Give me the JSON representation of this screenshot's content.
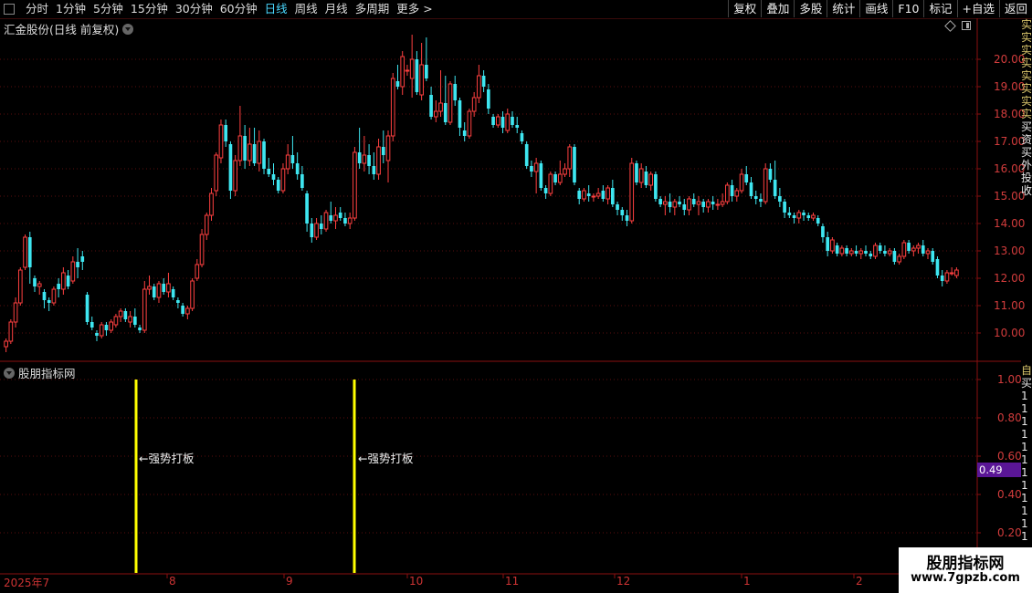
{
  "toolbar": {
    "periods": [
      {
        "label": "分时"
      },
      {
        "label": "1分钟"
      },
      {
        "label": "5分钟"
      },
      {
        "label": "15分钟"
      },
      {
        "label": "30分钟"
      },
      {
        "label": "60分钟"
      },
      {
        "label": "日线",
        "active": true
      },
      {
        "label": "周线"
      },
      {
        "label": "月线"
      },
      {
        "label": "多周期"
      },
      {
        "label": "更多"
      }
    ],
    "more_suffix": ">",
    "right_buttons": [
      "复权",
      "叠加",
      "多股",
      "统计",
      "画线",
      "F10",
      "标记",
      "+自选",
      "返回"
    ]
  },
  "main_chart": {
    "title": "汇金股份(日线 前复权)",
    "price_axis": [
      "20.00",
      "19.00",
      "18.00",
      "17.00",
      "16.00",
      "15.00",
      "14.00",
      "13.00",
      "12.00",
      "11.00",
      "10.00"
    ],
    "ymin": 9.0,
    "ymax": 20.9,
    "colors": {
      "up": "#ff4040",
      "down": "#3ee6f0",
      "grid": "#5a0e0e",
      "axis": "#8a1010",
      "axis_text": "#d23c3c"
    }
  },
  "indicator": {
    "title": "股朋指标网",
    "axis_labels": [
      "1.00",
      "0.80",
      "0.60",
      "0.40",
      "0.20"
    ],
    "current_value": "0.49",
    "signal_text": "←强势打板",
    "signal_color": "#ffff00"
  },
  "date_axis": {
    "labels": [
      "2025年7",
      "8",
      "9",
      "10",
      "11",
      "12",
      "1",
      "2"
    ]
  },
  "side_strip": {
    "top_chars": [
      "实",
      "实",
      "实",
      "实",
      "实",
      "实",
      "实",
      "实",
      "买",
      "资",
      "买",
      "外",
      "投",
      "收"
    ],
    "bottom_chars": [
      "自",
      "买",
      "1",
      "1",
      "1",
      "1",
      "1",
      "1",
      "1",
      "1",
      "1",
      "1",
      "1",
      "1"
    ]
  },
  "watermark": {
    "title": "股朋指标网",
    "url": "www.7gpzb.com"
  },
  "candles": [
    [
      9.5,
      9.8,
      9.3,
      9.7
    ],
    [
      9.7,
      10.5,
      9.6,
      10.4
    ],
    [
      10.4,
      11.3,
      10.2,
      11.1
    ],
    [
      11.1,
      12.4,
      11.0,
      12.3
    ],
    [
      12.4,
      13.6,
      12.3,
      13.5
    ],
    [
      13.5,
      13.7,
      11.8,
      12.4
    ],
    [
      12.0,
      12.1,
      11.5,
      11.7
    ],
    [
      11.7,
      11.9,
      11.4,
      11.8
    ],
    [
      11.5,
      11.6,
      10.9,
      11.2
    ],
    [
      11.2,
      11.3,
      10.8,
      11.1
    ],
    [
      11.1,
      11.7,
      11.0,
      11.6
    ],
    [
      11.8,
      12.0,
      11.3,
      11.6
    ],
    [
      11.6,
      12.4,
      11.4,
      12.2
    ],
    [
      12.1,
      12.3,
      11.6,
      11.7
    ],
    [
      11.9,
      12.8,
      11.8,
      12.6
    ],
    [
      12.6,
      13.1,
      12.0,
      12.4
    ],
    [
      12.8,
      13.0,
      12.3,
      12.6
    ],
    [
      11.4,
      11.5,
      10.3,
      10.4
    ],
    [
      10.4,
      10.6,
      10.1,
      10.2
    ],
    [
      10.0,
      10.1,
      9.7,
      9.9
    ],
    [
      9.9,
      10.4,
      9.8,
      10.3
    ],
    [
      10.3,
      10.4,
      9.9,
      10.1
    ],
    [
      10.1,
      10.5,
      10.0,
      10.4
    ],
    [
      10.3,
      10.7,
      10.2,
      10.6
    ],
    [
      10.6,
      10.9,
      10.4,
      10.8
    ],
    [
      10.8,
      10.9,
      10.4,
      10.5
    ],
    [
      10.4,
      10.8,
      10.2,
      10.6
    ],
    [
      10.6,
      10.9,
      10.2,
      10.3
    ],
    [
      10.2,
      10.3,
      10.0,
      10.1
    ],
    [
      10.1,
      11.9,
      10.0,
      11.6
    ],
    [
      11.6,
      12.1,
      11.4,
      11.7
    ],
    [
      11.7,
      11.8,
      11.2,
      11.3
    ],
    [
      11.3,
      11.9,
      11.1,
      11.8
    ],
    [
      11.8,
      12.0,
      11.4,
      11.5
    ],
    [
      11.5,
      12.2,
      11.3,
      11.8
    ],
    [
      11.6,
      11.7,
      11.2,
      11.3
    ],
    [
      11.2,
      11.3,
      10.9,
      11.1
    ],
    [
      11.0,
      11.1,
      10.6,
      10.7
    ],
    [
      10.7,
      11.0,
      10.5,
      10.9
    ],
    [
      10.9,
      12.0,
      10.8,
      11.9
    ],
    [
      12.0,
      12.7,
      11.9,
      12.5
    ],
    [
      12.5,
      13.8,
      12.4,
      13.6
    ],
    [
      13.6,
      14.4,
      13.4,
      14.3
    ],
    [
      14.3,
      15.3,
      14.1,
      15.1
    ],
    [
      15.2,
      16.6,
      15.0,
      16.5
    ],
    [
      16.4,
      17.8,
      16.2,
      17.6
    ],
    [
      17.6,
      17.8,
      16.8,
      17.0
    ],
    [
      16.9,
      17.0,
      14.9,
      15.2
    ],
    [
      15.2,
      16.5,
      15.0,
      16.3
    ],
    [
      16.3,
      18.3,
      16.1,
      17.2
    ],
    [
      17.2,
      17.6,
      16.0,
      16.3
    ],
    [
      16.3,
      17.5,
      16.1,
      16.9
    ],
    [
      16.9,
      17.5,
      16.1,
      16.2
    ],
    [
      16.2,
      17.4,
      15.9,
      17.0
    ],
    [
      17.0,
      17.1,
      15.8,
      16.0
    ],
    [
      16.0,
      16.4,
      15.7,
      15.8
    ],
    [
      15.8,
      16.2,
      15.4,
      15.6
    ],
    [
      15.6,
      15.7,
      15.1,
      15.2
    ],
    [
      15.2,
      16.2,
      15.1,
      16.0
    ],
    [
      16.0,
      16.9,
      15.8,
      16.5
    ],
    [
      16.5,
      17.2,
      16.0,
      16.2
    ],
    [
      16.2,
      16.6,
      15.6,
      15.8
    ],
    [
      15.8,
      16.1,
      15.2,
      15.3
    ],
    [
      15.1,
      15.2,
      13.7,
      14.0
    ],
    [
      14.0,
      14.2,
      13.3,
      13.5
    ],
    [
      13.5,
      14.2,
      13.4,
      14.0
    ],
    [
      14.0,
      14.3,
      13.6,
      13.8
    ],
    [
      13.8,
      14.5,
      13.7,
      14.4
    ],
    [
      14.3,
      14.8,
      14.0,
      14.1
    ],
    [
      14.1,
      14.6,
      13.8,
      14.3
    ],
    [
      14.4,
      14.6,
      14.1,
      14.2
    ],
    [
      14.2,
      14.4,
      13.9,
      14.0
    ],
    [
      14.0,
      14.4,
      13.8,
      14.2
    ],
    [
      14.2,
      16.8,
      14.1,
      16.6
    ],
    [
      16.6,
      17.5,
      16.0,
      16.2
    ],
    [
      16.2,
      17.2,
      15.9,
      16.5
    ],
    [
      16.5,
      16.9,
      15.8,
      16.1
    ],
    [
      16.1,
      16.6,
      15.6,
      15.8
    ],
    [
      15.8,
      17.1,
      15.6,
      16.8
    ],
    [
      16.8,
      17.4,
      16.2,
      16.5
    ],
    [
      16.3,
      17.4,
      15.5,
      17.2
    ],
    [
      17.2,
      19.5,
      17.0,
      19.3
    ],
    [
      19.2,
      19.8,
      18.9,
      19.0
    ],
    [
      19.0,
      20.3,
      18.7,
      20.1
    ],
    [
      19.6,
      19.8,
      19.4,
      19.6
    ],
    [
      19.3,
      20.9,
      18.6,
      20.0
    ],
    [
      20.0,
      20.3,
      18.7,
      18.8
    ],
    [
      18.7,
      20.6,
      18.5,
      19.8
    ],
    [
      19.8,
      20.8,
      19.2,
      19.3
    ],
    [
      18.7,
      19.0,
      17.8,
      17.9
    ],
    [
      17.9,
      18.5,
      17.7,
      18.1
    ],
    [
      18.1,
      19.6,
      17.9,
      18.4
    ],
    [
      18.4,
      19.4,
      17.6,
      17.7
    ],
    [
      17.7,
      19.2,
      17.6,
      19.1
    ],
    [
      19.1,
      19.4,
      18.3,
      18.5
    ],
    [
      18.5,
      18.6,
      17.2,
      17.5
    ],
    [
      17.4,
      17.7,
      17.0,
      17.2
    ],
    [
      17.2,
      18.2,
      17.1,
      18.1
    ],
    [
      18.1,
      18.8,
      17.9,
      18.6
    ],
    [
      18.6,
      19.8,
      18.4,
      19.4
    ],
    [
      19.4,
      19.6,
      18.8,
      19.0
    ],
    [
      18.9,
      19.1,
      18.0,
      18.2
    ],
    [
      17.9,
      18.0,
      17.5,
      17.6
    ],
    [
      17.6,
      18.0,
      17.5,
      17.9
    ],
    [
      17.9,
      18.1,
      17.3,
      17.5
    ],
    [
      17.4,
      18.2,
      17.3,
      18.0
    ],
    [
      17.9,
      18.1,
      17.5,
      17.6
    ],
    [
      17.6,
      17.9,
      17.3,
      17.5
    ],
    [
      17.3,
      17.4,
      16.9,
      17.0
    ],
    [
      16.9,
      17.0,
      16.0,
      16.1
    ],
    [
      16.1,
      16.3,
      15.7,
      15.9
    ],
    [
      15.9,
      16.4,
      15.1,
      16.2
    ],
    [
      16.2,
      16.3,
      15.2,
      15.3
    ],
    [
      15.3,
      15.4,
      14.9,
      15.1
    ],
    [
      15.1,
      15.9,
      15.0,
      15.8
    ],
    [
      15.8,
      15.9,
      15.4,
      15.5
    ],
    [
      15.5,
      16.3,
      15.4,
      15.8
    ],
    [
      15.8,
      16.2,
      15.7,
      16.0
    ],
    [
      16.0,
      16.9,
      15.7,
      16.8
    ],
    [
      16.8,
      16.9,
      15.4,
      15.5
    ],
    [
      15.2,
      15.3,
      14.7,
      14.9
    ],
    [
      14.9,
      15.3,
      14.8,
      15.2
    ],
    [
      15.1,
      15.4,
      14.8,
      15.0
    ],
    [
      15.0,
      15.1,
      14.8,
      15.0
    ],
    [
      15.0,
      15.3,
      14.9,
      15.1
    ],
    [
      15.2,
      15.4,
      14.8,
      14.9
    ],
    [
      14.9,
      15.4,
      14.7,
      15.3
    ],
    [
      15.3,
      15.6,
      14.6,
      14.7
    ],
    [
      14.7,
      14.8,
      14.3,
      14.5
    ],
    [
      14.5,
      14.6,
      14.1,
      14.3
    ],
    [
      14.3,
      14.5,
      13.9,
      14.1
    ],
    [
      14.1,
      16.4,
      14.0,
      16.2
    ],
    [
      16.2,
      16.3,
      15.4,
      15.5
    ],
    [
      15.5,
      16.2,
      15.3,
      16.0
    ],
    [
      15.9,
      16.1,
      15.3,
      15.4
    ],
    [
      15.4,
      15.9,
      15.2,
      15.8
    ],
    [
      15.8,
      15.9,
      14.8,
      14.9
    ],
    [
      14.9,
      15.0,
      14.6,
      14.7
    ],
    [
      14.7,
      15.0,
      14.3,
      14.8
    ],
    [
      14.8,
      15.1,
      14.4,
      14.6
    ],
    [
      14.6,
      14.9,
      14.3,
      14.8
    ],
    [
      14.8,
      15.0,
      14.6,
      14.7
    ],
    [
      14.7,
      14.9,
      14.3,
      14.5
    ],
    [
      14.5,
      15.0,
      14.3,
      14.9
    ],
    [
      14.9,
      15.1,
      14.6,
      14.7
    ],
    [
      14.7,
      15.0,
      14.3,
      14.8
    ],
    [
      14.8,
      14.9,
      14.4,
      14.6
    ],
    [
      14.6,
      14.9,
      14.4,
      14.8
    ],
    [
      14.8,
      15.0,
      14.5,
      14.7
    ],
    [
      14.7,
      14.9,
      14.5,
      14.7
    ],
    [
      14.7,
      15.1,
      14.6,
      14.8
    ],
    [
      14.8,
      15.5,
      14.7,
      15.4
    ],
    [
      15.4,
      15.6,
      14.8,
      15.0
    ],
    [
      15.0,
      15.3,
      14.8,
      15.2
    ],
    [
      15.2,
      16.0,
      15.1,
      15.8
    ],
    [
      15.8,
      16.1,
      15.4,
      15.5
    ],
    [
      15.5,
      15.7,
      14.9,
      15.0
    ],
    [
      15.0,
      15.2,
      14.7,
      14.9
    ],
    [
      14.9,
      15.1,
      14.6,
      14.8
    ],
    [
      14.8,
      16.2,
      14.7,
      16.0
    ],
    [
      16.0,
      16.2,
      15.5,
      15.6
    ],
    [
      15.6,
      16.3,
      14.9,
      15.0
    ],
    [
      15.0,
      15.3,
      14.6,
      14.8
    ],
    [
      14.8,
      14.9,
      14.2,
      14.4
    ],
    [
      14.4,
      14.6,
      14.2,
      14.3
    ],
    [
      14.3,
      14.4,
      14.0,
      14.2
    ],
    [
      14.2,
      14.5,
      14.0,
      14.4
    ],
    [
      14.4,
      14.5,
      14.1,
      14.3
    ],
    [
      14.3,
      14.4,
      14.1,
      14.2
    ],
    [
      14.2,
      14.4,
      14.1,
      14.3
    ],
    [
      14.2,
      14.3,
      13.9,
      14.0
    ],
    [
      13.9,
      14.0,
      13.3,
      13.5
    ],
    [
      13.5,
      13.7,
      12.8,
      13.0
    ],
    [
      13.0,
      13.5,
      12.9,
      13.4
    ],
    [
      13.2,
      13.3,
      12.8,
      12.9
    ],
    [
      12.9,
      13.2,
      12.8,
      13.1
    ],
    [
      13.1,
      13.2,
      12.8,
      12.9
    ],
    [
      12.9,
      13.1,
      12.8,
      13.0
    ],
    [
      13.0,
      13.2,
      12.8,
      12.9
    ],
    [
      12.9,
      13.1,
      12.7,
      13.0
    ],
    [
      13.0,
      13.2,
      12.8,
      12.9
    ],
    [
      12.9,
      13.0,
      12.7,
      12.8
    ],
    [
      12.8,
      13.3,
      12.7,
      13.2
    ],
    [
      13.2,
      13.3,
      12.9,
      13.0
    ],
    [
      13.0,
      13.2,
      12.8,
      12.9
    ],
    [
      12.9,
      13.1,
      12.8,
      13.0
    ],
    [
      13.0,
      13.1,
      12.5,
      12.6
    ],
    [
      12.6,
      12.9,
      12.5,
      12.8
    ],
    [
      12.8,
      13.4,
      12.7,
      13.3
    ],
    [
      13.3,
      13.4,
      12.9,
      13.0
    ],
    [
      13.0,
      13.2,
      12.8,
      13.1
    ],
    [
      13.1,
      13.3,
      12.9,
      13.2
    ],
    [
      13.2,
      13.4,
      12.8,
      12.9
    ],
    [
      12.9,
      13.1,
      12.7,
      13.0
    ],
    [
      13.0,
      13.1,
      12.5,
      12.6
    ],
    [
      12.7,
      12.8,
      12.0,
      12.1
    ],
    [
      12.1,
      12.3,
      11.7,
      11.9
    ],
    [
      11.9,
      12.3,
      11.8,
      12.2
    ],
    [
      12.2,
      12.4,
      12.1,
      12.2
    ],
    [
      12.1,
      12.4,
      12.0,
      12.3
    ]
  ]
}
